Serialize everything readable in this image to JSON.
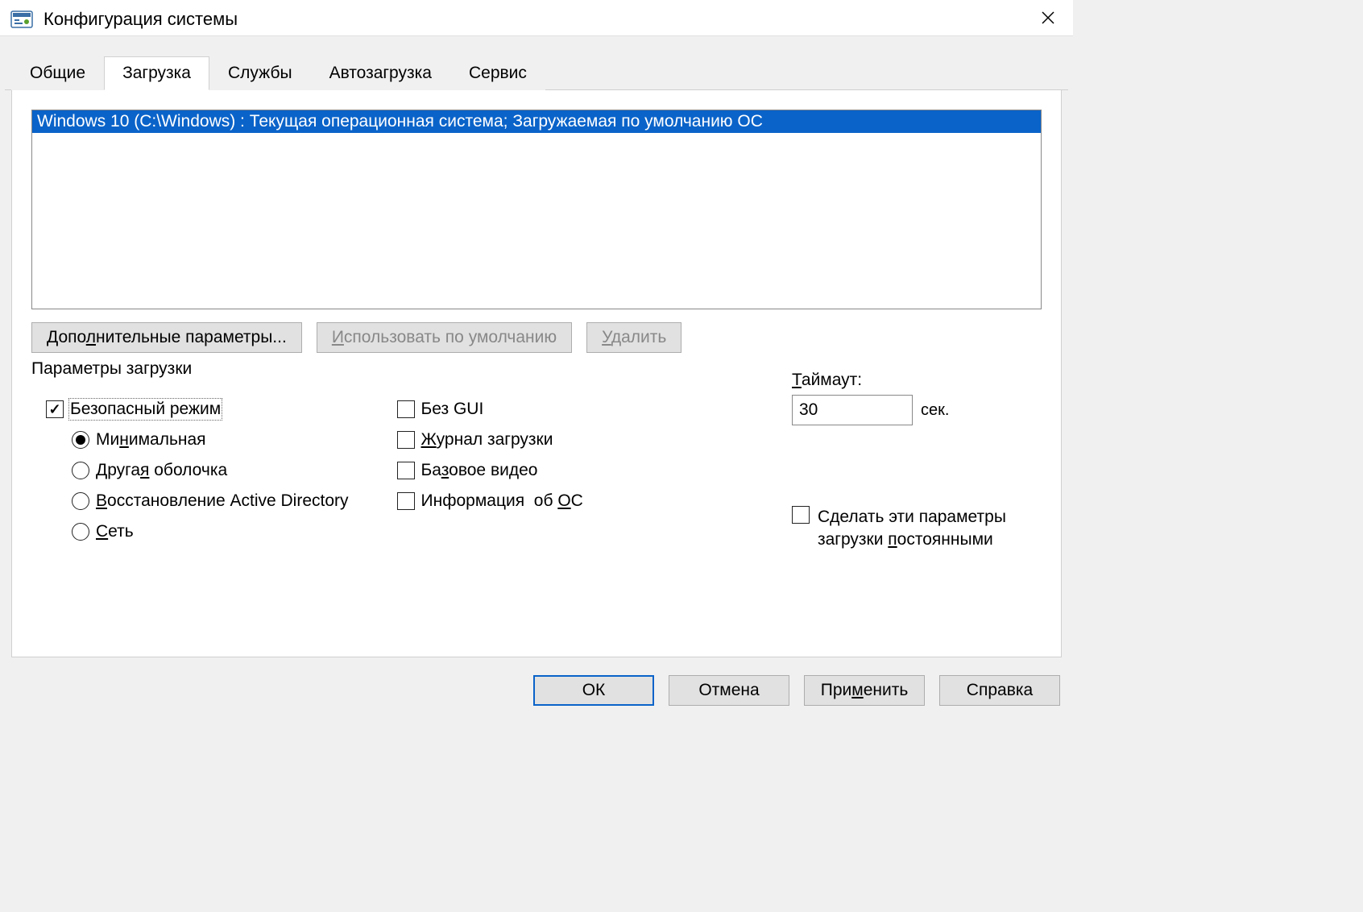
{
  "window": {
    "title": "Конфигурация системы"
  },
  "tabs": {
    "items": [
      "Общие",
      "Загрузка",
      "Службы",
      "Автозагрузка",
      "Сервис"
    ],
    "active_index": 1
  },
  "os_list": {
    "selected": "Windows 10 (C:\\Windows) : Текущая операционная система; Загружаемая по умолчанию ОС"
  },
  "buttons": {
    "advanced": "Дополнительные параметры...",
    "set_default": "Использовать по умолчанию",
    "delete": "Удалить"
  },
  "boot_options": {
    "group_label": "Параметры загрузки",
    "safe_mode": {
      "label": "Безопасный режим",
      "checked": true
    },
    "radios": {
      "minimal": {
        "label": "Минимальная",
        "checked": true
      },
      "altshell": {
        "label": "Другая оболочка",
        "checked": false
      },
      "adrepair": {
        "label": "Восстановление Active Directory",
        "checked": false
      },
      "network": {
        "label": "Сеть",
        "checked": false
      }
    },
    "checks": {
      "nogui": {
        "label": "Без GUI",
        "checked": false
      },
      "bootlog": {
        "label": "Журнал загрузки",
        "checked": false
      },
      "basevid": {
        "label": "Базовое видео",
        "checked": false
      },
      "osinfo": {
        "label": "Информация  об ОС",
        "checked": false
      }
    }
  },
  "timeout": {
    "label": "Таймаут:",
    "value": "30",
    "unit": "сек."
  },
  "persist": {
    "line1": "Сделать эти параметры",
    "line2": "загрузки постоянными",
    "checked": false
  },
  "footer": {
    "ok": "ОК",
    "cancel": "Отмена",
    "apply": "Применить",
    "help": "Справка"
  }
}
